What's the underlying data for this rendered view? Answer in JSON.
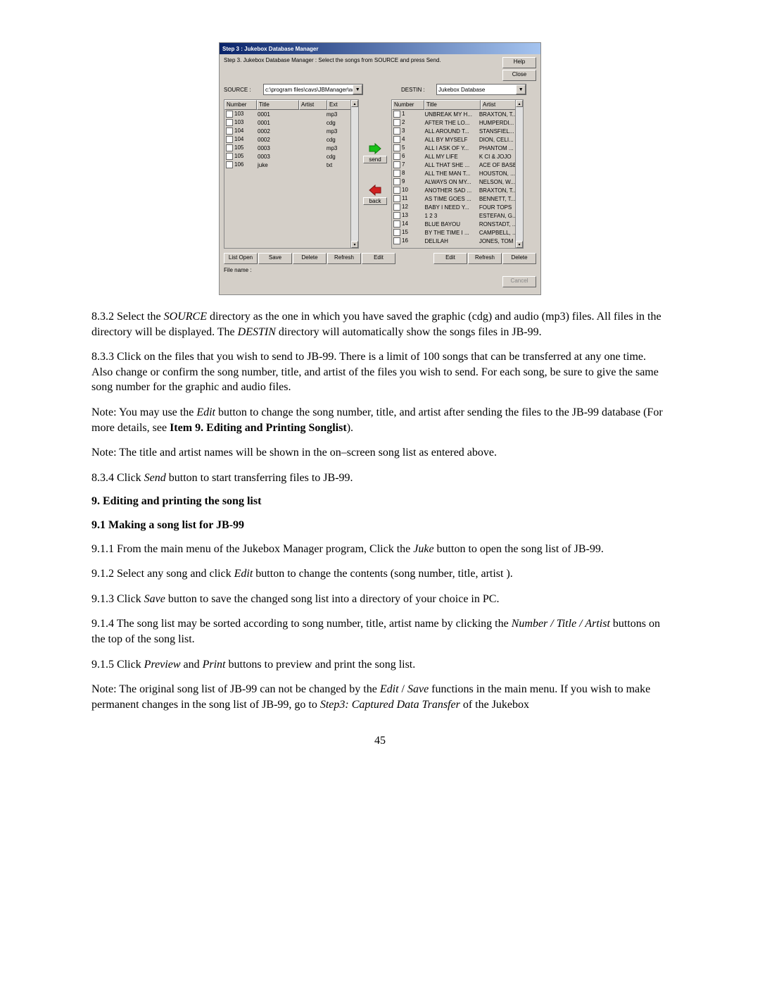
{
  "window": {
    "title": "Step 3 : Jukebox Database Manager",
    "instruction": "Step 3. Jukebox Database Manager : Select the songs from SOURCE and press Send.",
    "help_btn": "Help",
    "close_btn": "Close",
    "source_label": "SOURCE :",
    "source_path": "c:\\program files\\cavs\\JBManager\\wr",
    "destin_label": "DESTIN :",
    "destin_value": "Jukebox Database",
    "send_label": "send",
    "back_label": "back",
    "left_headers": {
      "number": "Number",
      "title": "Title",
      "artist": "Artist",
      "ext": "Ext"
    },
    "right_headers": {
      "number": "Number",
      "title": "Title",
      "artist": "Artist"
    },
    "left_rows": [
      {
        "n": "103",
        "t": "0001",
        "a": "",
        "e": "mp3"
      },
      {
        "n": "103",
        "t": "0001",
        "a": "",
        "e": "cdg"
      },
      {
        "n": "104",
        "t": "0002",
        "a": "",
        "e": "mp3"
      },
      {
        "n": "104",
        "t": "0002",
        "a": "",
        "e": "cdg"
      },
      {
        "n": "105",
        "t": "0003",
        "a": "",
        "e": "mp3"
      },
      {
        "n": "105",
        "t": "0003",
        "a": "",
        "e": "cdg"
      },
      {
        "n": "106",
        "t": "juke",
        "a": "",
        "e": "txt"
      }
    ],
    "right_rows": [
      {
        "n": "1",
        "t": "UNBREAK MY H...",
        "a": "BRAXTON, T..."
      },
      {
        "n": "2",
        "t": "AFTER THE LO...",
        "a": "HUMPERDI..."
      },
      {
        "n": "3",
        "t": "ALL AROUND T...",
        "a": "STANSFIEL..."
      },
      {
        "n": "4",
        "t": "ALL BY MYSELF",
        "a": "DION, CELI..."
      },
      {
        "n": "5",
        "t": "ALL I ASK OF Y...",
        "a": "PHANTOM ..."
      },
      {
        "n": "6",
        "t": "ALL MY LIFE",
        "a": "K CI & JOJO"
      },
      {
        "n": "7",
        "t": "ALL THAT SHE ...",
        "a": "ACE OF BASE"
      },
      {
        "n": "8",
        "t": "ALL THE MAN T...",
        "a": "HOUSTON, ..."
      },
      {
        "n": "9",
        "t": "ALWAYS ON MY...",
        "a": "NELSON, W..."
      },
      {
        "n": "10",
        "t": "ANOTHER SAD ...",
        "a": "BRAXTON, T..."
      },
      {
        "n": "11",
        "t": "AS TIME GOES ...",
        "a": "BENNETT, T..."
      },
      {
        "n": "12",
        "t": "BABY I NEED Y...",
        "a": "FOUR TOPS"
      },
      {
        "n": "13",
        "t": "1 2 3",
        "a": "ESTEFAN, G..."
      },
      {
        "n": "14",
        "t": "BLUE BAYOU",
        "a": "RONSTADT, ..."
      },
      {
        "n": "15",
        "t": "BY THE TIME I ...",
        "a": "CAMPBELL, ..."
      },
      {
        "n": "16",
        "t": "DELILAH",
        "a": "JONES, TOM"
      }
    ],
    "left_buttons": [
      "List Open",
      "Save",
      "Delete",
      "Refresh",
      "Edit"
    ],
    "right_buttons": [
      "Edit",
      "Refresh",
      "Delete"
    ],
    "filename_label": "File name :",
    "cancel_btn": "Cancel"
  },
  "doc": {
    "p832_a": "8.3.2 Select the ",
    "p832_i1": "SOURCE",
    "p832_b": " directory as the one in which you have saved the graphic (cdg) and audio (mp3) files. All files in the directory will be displayed.    The ",
    "p832_i2": "DESTIN",
    "p832_c": " directory will automatically show the songs files in JB-99.",
    "p833": "8.3.3 Click on the files that you wish to send to JB-99.    There is a limit of 100 songs that can be transferred at any one time.    Also change or confirm the song number, title, and artist of the files you wish to send.    For each song, be sure to give the same song number for the graphic and audio files.",
    "note1_a": "Note: You may use the ",
    "note1_i1": "Edit",
    "note1_b": " button to change the song number, title, and artist after sending the files to the JB-99 database (For more details, see ",
    "note1_bold": "Item 9. Editing and Printing Songlist",
    "note1_c": ").",
    "note2": "Note: The title and artist names will be shown in the on–screen song list as entered above.",
    "p834_a": "8.3.4 Click ",
    "p834_i": "Send",
    "p834_b": " button to start transferring files to JB-99.",
    "h9": "9. Editing and printing the song list",
    "h91": "9.1 Making a song list for JB-99",
    "p911_a": "9.1.1 From the main menu of the Jukebox Manager program, Click the ",
    "p911_i": "Juke",
    "p911_b": " button to open the song list of JB-99.",
    "p912_a": "9.1.2 Select any song and click ",
    "p912_i": "Edit",
    "p912_b": " button to change the contents (song number, title, artist ).",
    "p913_a": "9.1.3 Click ",
    "p913_i": "Save",
    "p913_b": " button to save the changed song list into a directory of your choice in PC.",
    "p914_a": "9.1.4 The song list may be sorted according to song number, title, artist name by clicking the ",
    "p914_i": "Number / Title / Artist",
    "p914_b": " buttons on the top of the song list.",
    "p915_a": "9.1.5 Click ",
    "p915_i1": "Preview",
    "p915_mid": " and ",
    "p915_i2": "Print",
    "p915_b": " buttons to preview and print the song list.",
    "note3_a": "Note: The original song list of JB-99 can not be changed by the ",
    "note3_i1": "Edit",
    "note3_mid1": " / ",
    "note3_i2": "Save",
    "note3_b": " functions in the main menu.    If you wish to make permanent changes in the song list of JB-99, go to ",
    "note3_i3": "Step3: Captured Data Transfer",
    "note3_c": " of the Jukebox",
    "pagenum": "45"
  }
}
